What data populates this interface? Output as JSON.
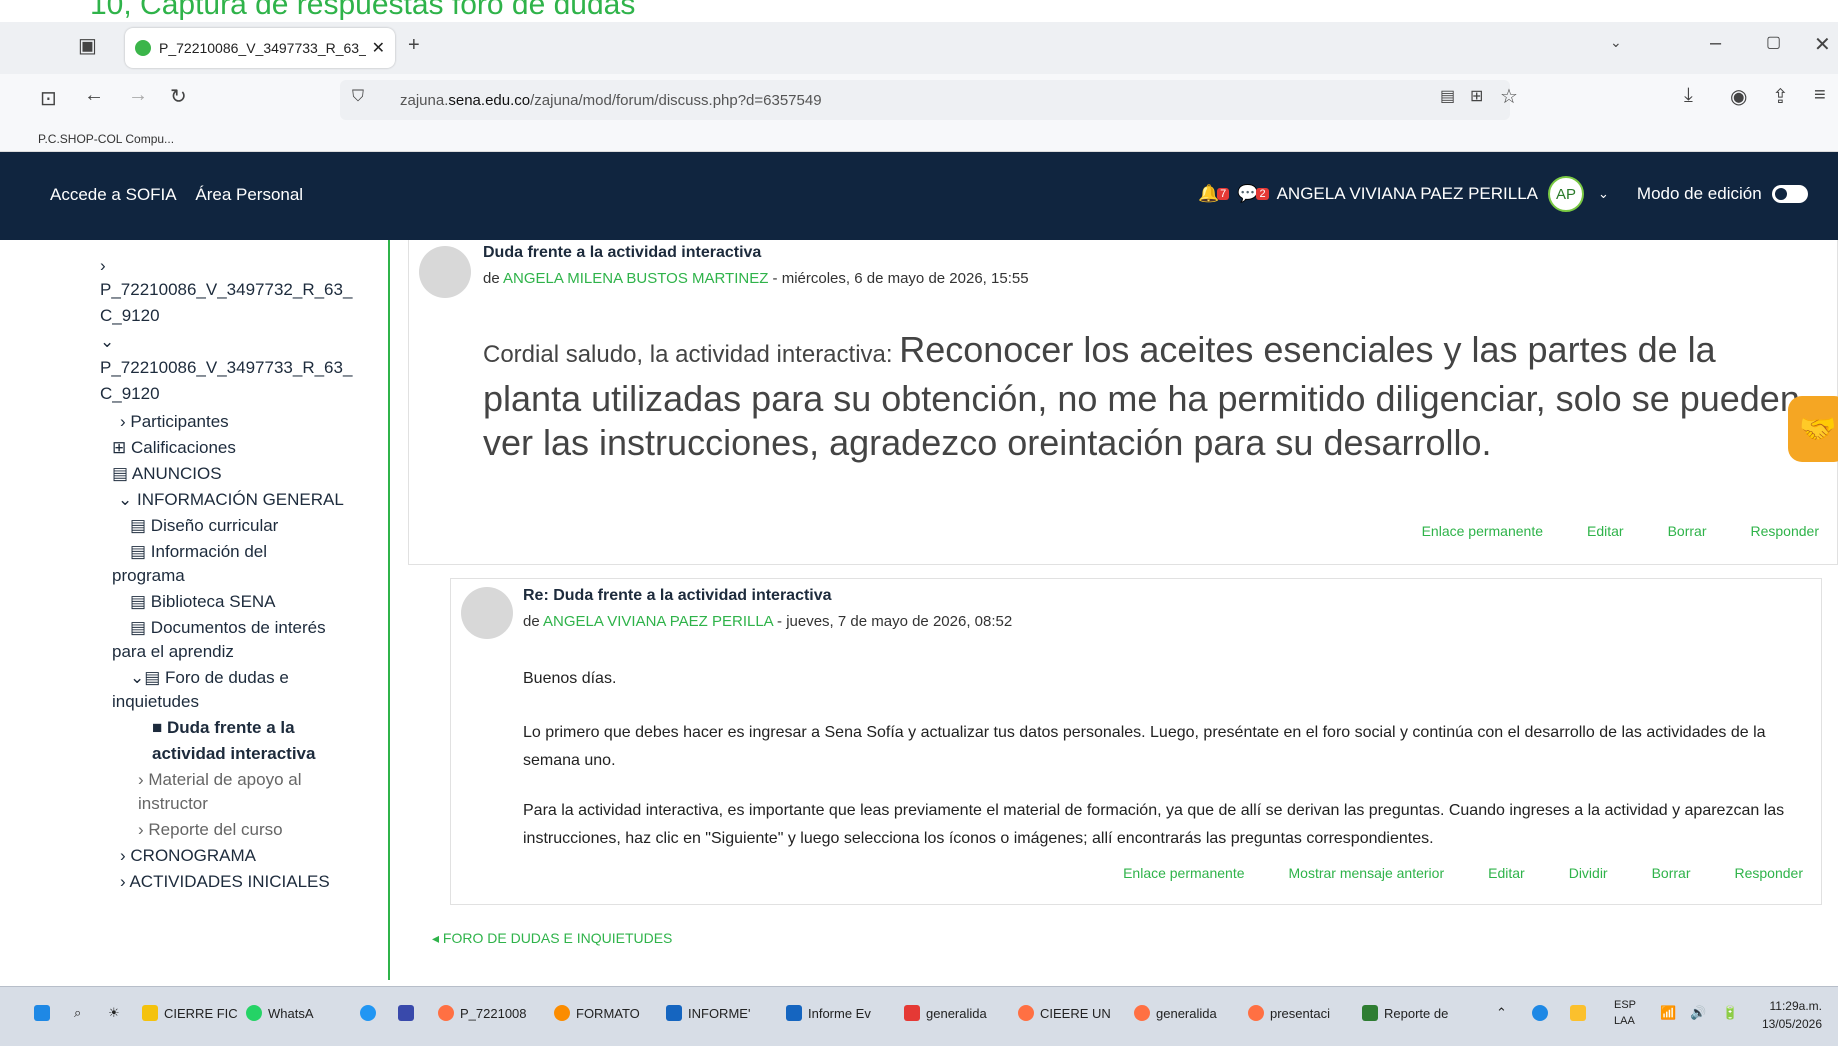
{
  "caption": "10, Captura de respuestas foro de dudas",
  "browser": {
    "tab_title": "P_72210086_V_3497733_R_63_(",
    "url_prefix": "zajuna.",
    "url_domain": "sena.edu.co",
    "url_path": "/zajuna/mod/forum/discuss.php?d=6357549",
    "bookmark": "P.C.SHOP-COL Compu..."
  },
  "header": {
    "nav1": "Accede a SOFIA",
    "nav2": "Área Personal",
    "notif_count": "7",
    "msg_count": "2",
    "user_name": "ANGELA VIVIANA PAEZ PERILLA",
    "avatar": "AP",
    "edit_mode": "Modo de edición"
  },
  "sidebar": {
    "item1a": "P_72210086_V_3497732_R_63_",
    "item1b": "C_9120",
    "item2a": "P_72210086_V_3497733_R_63_",
    "item2b": "C_9120",
    "participantes": "Participantes",
    "calificaciones": "Calificaciones",
    "anuncios": "ANUNCIOS",
    "info_general": "INFORMACIÓN GENERAL",
    "diseno": "Diseño curricular",
    "info_prog_a": "Información del",
    "info_prog_b": "programa",
    "biblioteca": "Biblioteca SENA",
    "docs_a": "Documentos de interés",
    "docs_b": "para el aprendiz",
    "foro_a": "Foro de dudas e",
    "foro_b": "inquietudes",
    "duda_a": "Duda frente a la",
    "duda_b": "actividad interactiva",
    "material_a": "Material de apoyo al",
    "material_b": "instructor",
    "reporte": "Reporte del curso",
    "cronograma": "CRONOGRAMA",
    "actividades": "ACTIVIDADES INICIALES"
  },
  "post1": {
    "title": "Duda frente a la actividad interactiva",
    "by": "de",
    "author": "ANGELA MILENA BUSTOS MARTINEZ",
    "date": " - miércoles, 6 de mayo de 2026, 15:55",
    "body_small": "Cordial saludo, la actividad interactiva: ",
    "body_large": "Reconocer los aceites esenciales y las partes de la planta utilizadas para su obtención, no me ha permitido diligenciar, solo se pueden ver las instrucciones, agradezco oreintación para su desarrollo.",
    "actions": [
      "Enlace permanente",
      "Editar",
      "Borrar",
      "Responder"
    ]
  },
  "post2": {
    "title": "Re: Duda frente a la actividad interactiva",
    "by": "de",
    "author": "ANGELA VIVIANA PAEZ PERILLA",
    "date": " - jueves, 7 de mayo de 2026, 08:52",
    "p1": "Buenos días.",
    "p2": "Lo primero que debes hacer es ingresar a Sena Sofía y actualizar tus datos personales. Luego, preséntate en el foro social y continúa con el desarrollo de las actividades de la semana uno.",
    "p3": "Para la actividad interactiva, es importante que leas previamente el material de formación, ya que de allí se derivan las preguntas. Cuando ingreses a la actividad y aparezcan las instrucciones, haz clic en \"Siguiente\" y luego selecciona los íconos o imágenes; allí encontrarás las preguntas correspondientes.",
    "actions": [
      "Enlace permanente",
      "Mostrar mensaje anterior",
      "Editar",
      "Dividir",
      "Borrar",
      "Responder"
    ]
  },
  "back_link": "FORO DE DUDAS E INQUIETUDES",
  "taskbar": {
    "apps": [
      "CIERRE FIC",
      "WhatsA",
      "P_7221008",
      "FORMATO",
      "INFORME'",
      "Informe Ev",
      "generalida",
      "CIEERE UN",
      "generalida",
      "presentaci",
      "Reporte de"
    ],
    "lang1": "ESP",
    "lang2": "LAA",
    "time": "11:29a.m.",
    "date": "13/05/2026"
  },
  "colors": {
    "header_bg": "#10253f",
    "accent_green": "#2fb34a"
  }
}
